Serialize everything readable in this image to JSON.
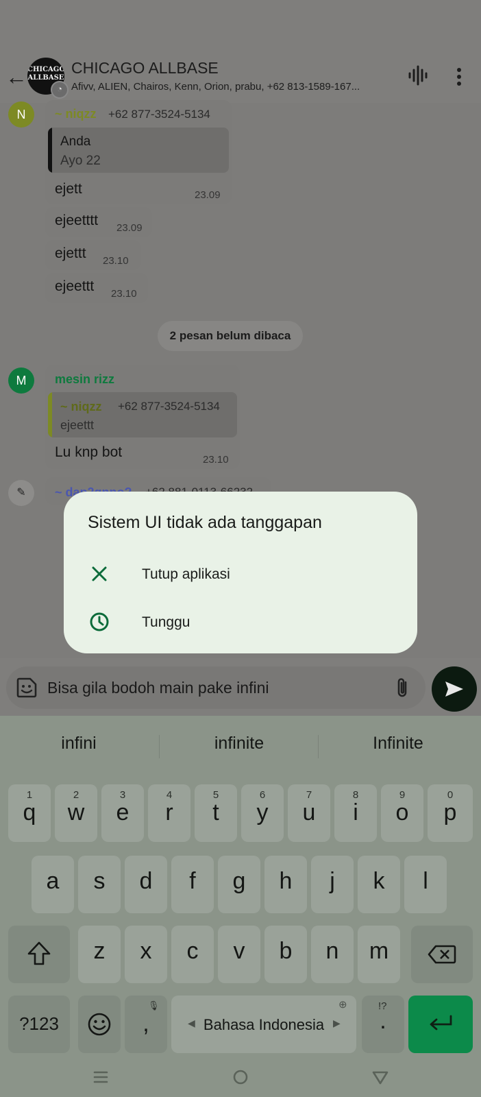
{
  "header": {
    "group_avatar_text": "CHICAGO ALLBASE",
    "group_name": "CHICAGO ALLBASE",
    "members": "Afivv, ALIEN, Chairos, Kenn, Orion, prabu, +62 813-1589-167..."
  },
  "messages": {
    "first": {
      "avatar_letter": "N",
      "sender": "~ niqzz",
      "phone": "+62 877-3524-5134",
      "quote_author": "Anda",
      "quote_text": "Ayo 22",
      "text": "ejett",
      "time": "23.09"
    },
    "m2": {
      "text": "ejeetttt",
      "time": "23.09"
    },
    "m3": {
      "text": "ejettt",
      "time": "23.10"
    },
    "m4": {
      "text": "ejeettt",
      "time": "23.10"
    },
    "unread": "2 pesan belum dibaca",
    "second": {
      "avatar_letter": "M",
      "sender": "mesin rizz",
      "quote_author": "~ niqzz",
      "quote_phone": "+62 877-3524-5134",
      "quote_text": "ejeettt",
      "text": "Lu knp bot",
      "time": "23.10"
    },
    "third": {
      "sender": "~ dap2gnno?",
      "phone": "+62 881-0113-66232"
    }
  },
  "dialog": {
    "title": "Sistem UI tidak ada tanggapan",
    "option_close": "Tutup aplikasi",
    "option_wait": "Tunggu"
  },
  "input": {
    "text": "Bisa gila bodoh main pake infini"
  },
  "keyboard": {
    "suggestions": [
      "infini",
      "infinite",
      "Infinite"
    ],
    "row1": [
      {
        "ch": "q",
        "hint": "1"
      },
      {
        "ch": "w",
        "hint": "2"
      },
      {
        "ch": "e",
        "hint": "3"
      },
      {
        "ch": "r",
        "hint": "4"
      },
      {
        "ch": "t",
        "hint": "5"
      },
      {
        "ch": "y",
        "hint": "6"
      },
      {
        "ch": "u",
        "hint": "7"
      },
      {
        "ch": "i",
        "hint": "8"
      },
      {
        "ch": "o",
        "hint": "9"
      },
      {
        "ch": "p",
        "hint": "0"
      }
    ],
    "row2": [
      "a",
      "s",
      "d",
      "f",
      "g",
      "h",
      "j",
      "k",
      "l"
    ],
    "row3": [
      "z",
      "x",
      "c",
      "v",
      "b",
      "n",
      "m"
    ],
    "symbols_label": "?123",
    "comma": ",",
    "space_label": "Bahasa Indonesia",
    "period": ".",
    "period_hint": "!?"
  },
  "colors": {
    "accent_green": "#0c8a4a",
    "dialog_bg": "#e9f2e7",
    "sender1": "#7d8a24",
    "sender2": "#0e7a3e",
    "sender3": "#4a56b0"
  }
}
